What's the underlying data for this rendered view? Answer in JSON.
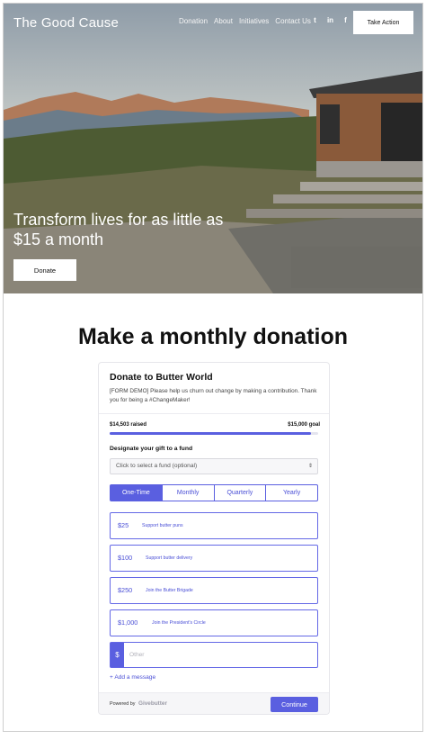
{
  "header": {
    "brand": "The Good Cause",
    "nav": [
      "Donation",
      "About",
      "Initiatives",
      "Contact Us"
    ],
    "social": [
      {
        "icon": "twitter-icon",
        "glyph": "t"
      },
      {
        "icon": "linkedin-icon",
        "glyph": "in"
      },
      {
        "icon": "facebook-icon",
        "glyph": "f"
      }
    ],
    "cta": "Take Action"
  },
  "hero": {
    "title": "Transform lives for as little as $15 a month",
    "button": "Donate"
  },
  "main": {
    "heading": "Make a monthly donation"
  },
  "form": {
    "title": "Donate to Butter World",
    "description": "[FORM DEMO] Please help us churn out change by making a contribution. Thank you for being a #ChangeMaker!",
    "raised": "$14,503 raised",
    "goal": "$15,000 goal",
    "progress_fraction": 0.967,
    "fund_label": "Designate your gift to a fund",
    "fund_select": "Click to select a fund (optional)",
    "frequencies": [
      "One-Time",
      "Monthly",
      "Quarterly",
      "Yearly"
    ],
    "selected_frequency": "One-Time",
    "amounts": [
      {
        "value": "$25",
        "desc": "Support butter puns"
      },
      {
        "value": "$100",
        "desc": "Support butter delivery"
      },
      {
        "value": "$250",
        "desc": "Join the Butter Brigade"
      },
      {
        "value": "$1,000",
        "desc": "Join the President's Circle"
      }
    ],
    "other_currency": "$",
    "other_placeholder": "Other",
    "add_message": "+ Add a message",
    "powered_by": "Powered by",
    "provider": "Givebutter",
    "continue": "Continue"
  },
  "colors": {
    "accent": "#5a5fe0",
    "progress_track": "#e4e4ee"
  }
}
